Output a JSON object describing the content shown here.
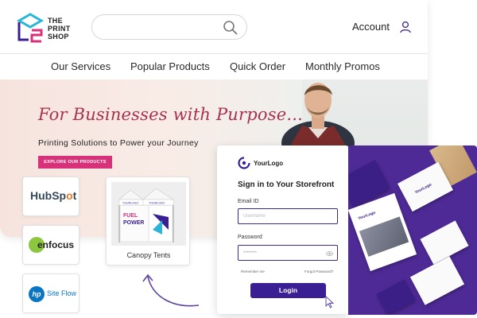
{
  "brand": {
    "name_lines": [
      "THE",
      "PRINT",
      "SHOP"
    ],
    "colors": {
      "pink": "#d9307a",
      "purple": "#3a1f94",
      "cyan": "#2bb6d9"
    }
  },
  "header": {
    "search": {
      "placeholder": "",
      "icon": "search-icon"
    },
    "account_label": "Account",
    "account_icon": "user-icon"
  },
  "nav": {
    "items": [
      "Our Services",
      "Popular Products",
      "Quick Order",
      "Monthly Promos"
    ]
  },
  "hero": {
    "tagline": "For Businesses with Purpose...",
    "subtitle": "Printing Solutions to Power your Journey",
    "cta_label": "EXPLORE OUR PRODUCTS"
  },
  "partners": {
    "hubspot": {
      "before": "HubSp",
      "o": "o",
      "after": "t"
    },
    "enfocus": "enfocus",
    "hp": {
      "badge": "hp",
      "label": "Site Flow"
    }
  },
  "product_card": {
    "label": "Canopy Tents",
    "image_text": [
      "YOURLOGO",
      "FUEL",
      "POWER"
    ]
  },
  "signin": {
    "logo_text": "YourLogo",
    "title": "Sign in to Your Storefront",
    "email_label": "Email ID",
    "email_placeholder": "Username",
    "password_label": "Password",
    "password_placeholder": "••••••••",
    "remember_label": "Remember me",
    "forgot_label": "Forgot Password?",
    "login_label": "Login"
  },
  "brand_panel": {
    "card_text": "YourLogo"
  }
}
